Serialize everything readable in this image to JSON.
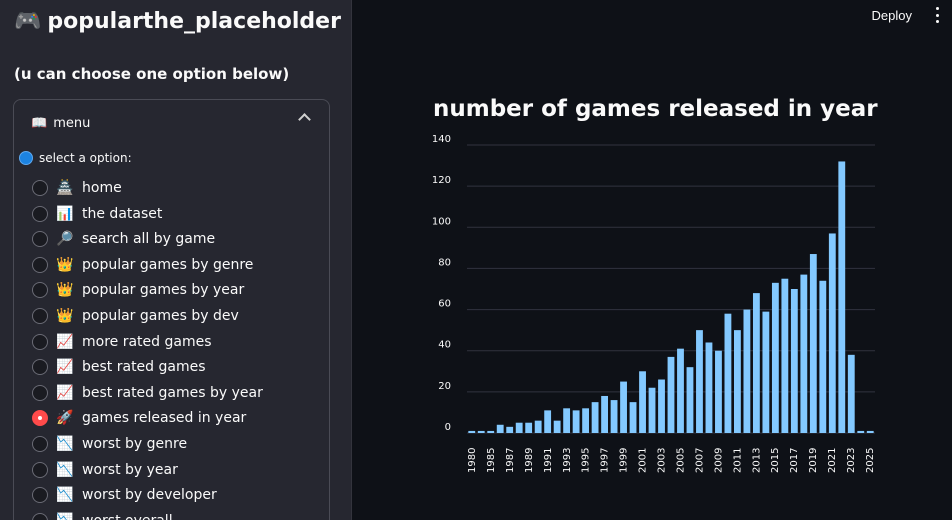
{
  "sidebar": {
    "app_title": "popularthe_placeholder",
    "subtitle": "(u can choose one option below)",
    "expander_title": "menu",
    "radio_label": "select a option:",
    "options": [
      {
        "icon": "🏯",
        "label": "home",
        "selected": false
      },
      {
        "icon": "📊",
        "label": "the dataset",
        "selected": false
      },
      {
        "icon": "🔎",
        "label": "search all by game",
        "selected": false
      },
      {
        "icon": "👑",
        "label": "popular games by genre",
        "selected": false
      },
      {
        "icon": "👑",
        "label": "popular games by year",
        "selected": false
      },
      {
        "icon": "👑",
        "label": "popular games by dev",
        "selected": false
      },
      {
        "icon": "📈",
        "label": "more rated games",
        "selected": false
      },
      {
        "icon": "📈",
        "label": "best rated games",
        "selected": false
      },
      {
        "icon": "📈",
        "label": "best rated games by year",
        "selected": false
      },
      {
        "icon": "🚀",
        "label": "games released in year",
        "selected": true
      },
      {
        "icon": "📉",
        "label": "worst by genre",
        "selected": false
      },
      {
        "icon": "📉",
        "label": "worst by year",
        "selected": false
      },
      {
        "icon": "📉",
        "label": "worst by developer",
        "selected": false
      },
      {
        "icon": "📉",
        "label": "worst overall",
        "selected": false
      }
    ]
  },
  "header": {
    "deploy_label": "Deploy"
  },
  "colors": {
    "bar": "#83c9ff",
    "accent": "#ff4b4b",
    "grid": "#31333f"
  },
  "chart_data": {
    "type": "bar",
    "title": "number of games released in year",
    "xlabel": "",
    "ylabel": "",
    "ylim": [
      0,
      140
    ],
    "y_ticks": [
      0,
      20,
      40,
      60,
      80,
      100,
      120,
      140
    ],
    "x_tick_labels": [
      "1980",
      "1985",
      "1987",
      "1989",
      "1991",
      "1993",
      "1995",
      "1997",
      "1999",
      "2001",
      "2003",
      "2005",
      "2007",
      "2009",
      "2011",
      "2013",
      "2015",
      "2017",
      "2019",
      "2021",
      "2023",
      "2025"
    ],
    "categories": [
      1980,
      1983,
      1985,
      1986,
      1987,
      1988,
      1989,
      1990,
      1991,
      1992,
      1993,
      1994,
      1995,
      1996,
      1997,
      1998,
      1999,
      2000,
      2001,
      2002,
      2003,
      2004,
      2005,
      2006,
      2007,
      2008,
      2009,
      2010,
      2011,
      2012,
      2013,
      2014,
      2015,
      2016,
      2017,
      2018,
      2019,
      2020,
      2021,
      2022,
      2023,
      2024,
      2025
    ],
    "values": [
      1,
      1,
      1,
      4,
      3,
      5,
      5,
      6,
      11,
      6,
      12,
      11,
      12,
      15,
      18,
      16,
      25,
      15,
      30,
      22,
      26,
      37,
      41,
      32,
      50,
      44,
      40,
      58,
      50,
      60,
      68,
      59,
      73,
      75,
      70,
      77,
      87,
      74,
      97,
      132,
      38,
      1,
      1
    ],
    "grid": true,
    "legend": "none"
  }
}
